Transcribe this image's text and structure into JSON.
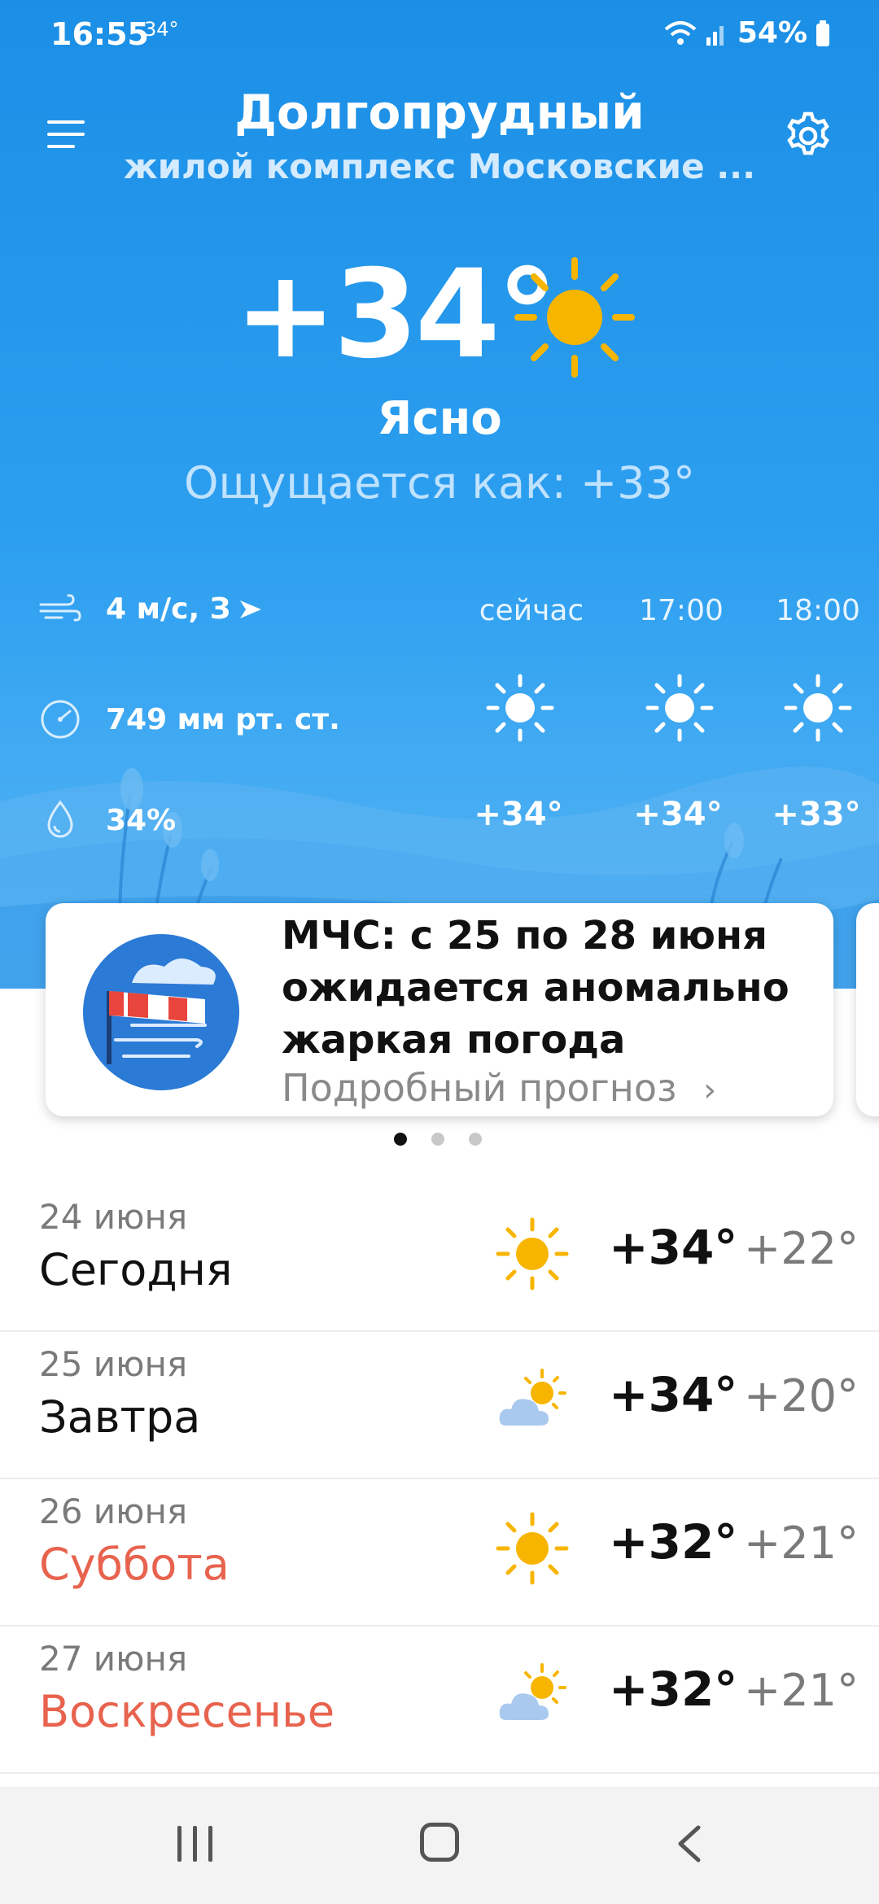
{
  "status_bar": {
    "time": "16:55",
    "temp": "34°",
    "battery": "54%"
  },
  "header": {
    "city": "Долгопрудный",
    "sublocation": "жилой комплекс Московские ..."
  },
  "current": {
    "temperature": "+34°",
    "condition": "Ясно",
    "feels_like": "Ощущается как: +33°"
  },
  "metrics": {
    "wind": "4 м/с, З",
    "pressure": "749 мм рт. ст.",
    "humidity": "34%"
  },
  "hourly": [
    {
      "label": "сейчас",
      "icon": "sun-icon",
      "temp": "+34°"
    },
    {
      "label": "17:00",
      "icon": "sun-icon",
      "temp": "+34°"
    },
    {
      "label": "18:00",
      "icon": "sun-icon",
      "temp": "+33°"
    }
  ],
  "alert_card": {
    "title": "МЧС: с 25 по 28 июня ожидается аномально жаркая погода",
    "link": "Подробный прогноз",
    "icon": "windsock-icon"
  },
  "pager": {
    "total": 3,
    "active": 0
  },
  "daily": [
    {
      "date": "24 июня",
      "name": "Сегодня",
      "weekend": false,
      "icon": "sun-icon",
      "max": "+34°",
      "min": "+22°"
    },
    {
      "date": "25 июня",
      "name": "Завтра",
      "weekend": false,
      "icon": "partly-cloudy-icon",
      "max": "+34°",
      "min": "+20°"
    },
    {
      "date": "26 июня",
      "name": "Суббота",
      "weekend": true,
      "icon": "sun-icon",
      "max": "+32°",
      "min": "+21°"
    },
    {
      "date": "27 июня",
      "name": "Воскресенье",
      "weekend": true,
      "icon": "partly-cloudy-icon",
      "max": "+32°",
      "min": "+21°"
    }
  ],
  "colors": {
    "sky_top": "#1b8fe6",
    "sun": "#f7b500",
    "weekend": "#e8634e"
  }
}
